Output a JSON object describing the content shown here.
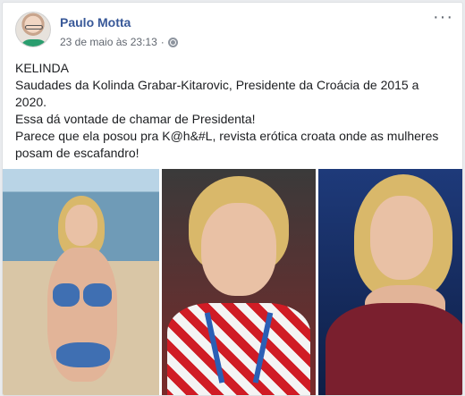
{
  "post": {
    "author": "Paulo Motta",
    "timestamp": "23 de maio às 23:13",
    "separator": "·",
    "more_icon": "more-options-icon",
    "privacy_icon": "globe-icon",
    "text_lines": [
      "KELINDA",
      "Saudades da Kolinda Grabar-Kitarovic, Presidente da Croácia de 2015 a",
      "2020.",
      "Essa dá vontade de chamar de Presidenta!",
      "Parece que ela posou pra K@h&#L, revista erótica croata onde as mulheres",
      "posam de escafandro!"
    ]
  },
  "colors": {
    "author_link": "#385898",
    "meta_text": "#616770",
    "body_text": "#1c1e21",
    "page_bg": "#e9ebee"
  }
}
